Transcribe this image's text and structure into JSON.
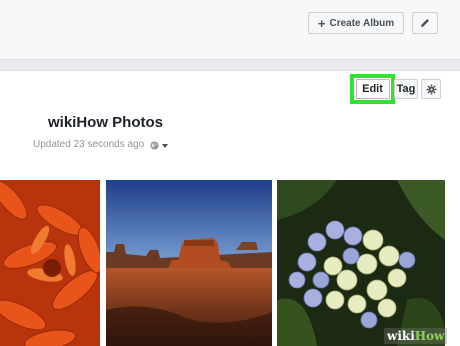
{
  "header": {
    "create_album_label": "Create Album",
    "create_album_icon": "plus-icon",
    "edit_album_icon": "pencil-icon"
  },
  "album": {
    "title": "wikiHow Photos",
    "updated_text": "Updated 23 seconds ago",
    "privacy_icon": "globe-icon"
  },
  "actions": {
    "edit_label": "Edit",
    "tag_label": "Tag",
    "settings_icon": "gear-icon",
    "highlight_color": "#32e132"
  },
  "photos": [
    {
      "name": "orange-dahlia"
    },
    {
      "name": "desert-butte"
    },
    {
      "name": "hydrangea"
    }
  ],
  "watermark": {
    "wiki": "wiki",
    "how": "How"
  },
  "colors": {
    "page_bg": "#e9ebee",
    "panel_bg": "#ffffff",
    "text_primary": "#1d2129",
    "text_secondary": "#90949c"
  }
}
